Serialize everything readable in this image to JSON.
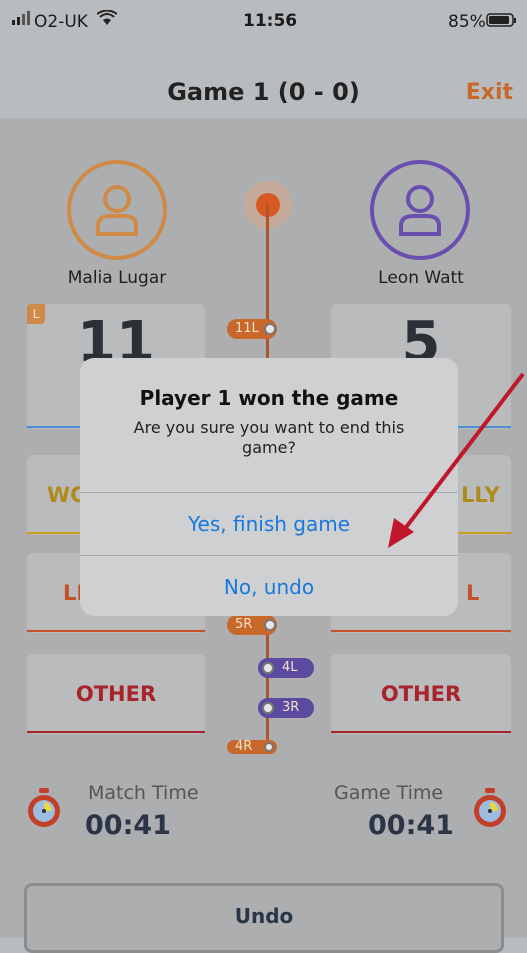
{
  "status": {
    "carrier": "O2-UK",
    "time": "11:56",
    "battery": "85%"
  },
  "header": {
    "title": "Game 1 (0 - 0)",
    "exit_label": "Exit"
  },
  "players": {
    "left": {
      "name": "Malia Lugar",
      "score": "11",
      "badge": "L",
      "color": "#d08a48"
    },
    "right": {
      "name": "Leon Watt",
      "score": "5",
      "color": "#6a4fb0"
    }
  },
  "tiles": {
    "left": {
      "row1": "WC",
      "row2": "LE",
      "row3": "OTHER"
    },
    "right": {
      "row1": "LLY",
      "row2": "L",
      "row3": "OTHER"
    }
  },
  "timeline": {
    "top_pill": "11L",
    "pill_5r": "5R",
    "pill_4l": "4L",
    "pill_3r": "3R",
    "pill_4r": "4R"
  },
  "modal": {
    "title": "Player 1 won the game",
    "message": "Are you sure you want to end this game?",
    "confirm_label": "Yes, finish game",
    "undo_label": "No, undo"
  },
  "timers": {
    "match_label": "Match Time",
    "match_value": "00:41",
    "game_label": "Game Time",
    "game_value": "00:41"
  },
  "bottom": {
    "undo_label": "Undo"
  },
  "colors": {
    "accent_orange": "#c8682a",
    "blue_link": "#1779dd",
    "purple": "#6a4fb0",
    "red_label": "#a8232a"
  }
}
